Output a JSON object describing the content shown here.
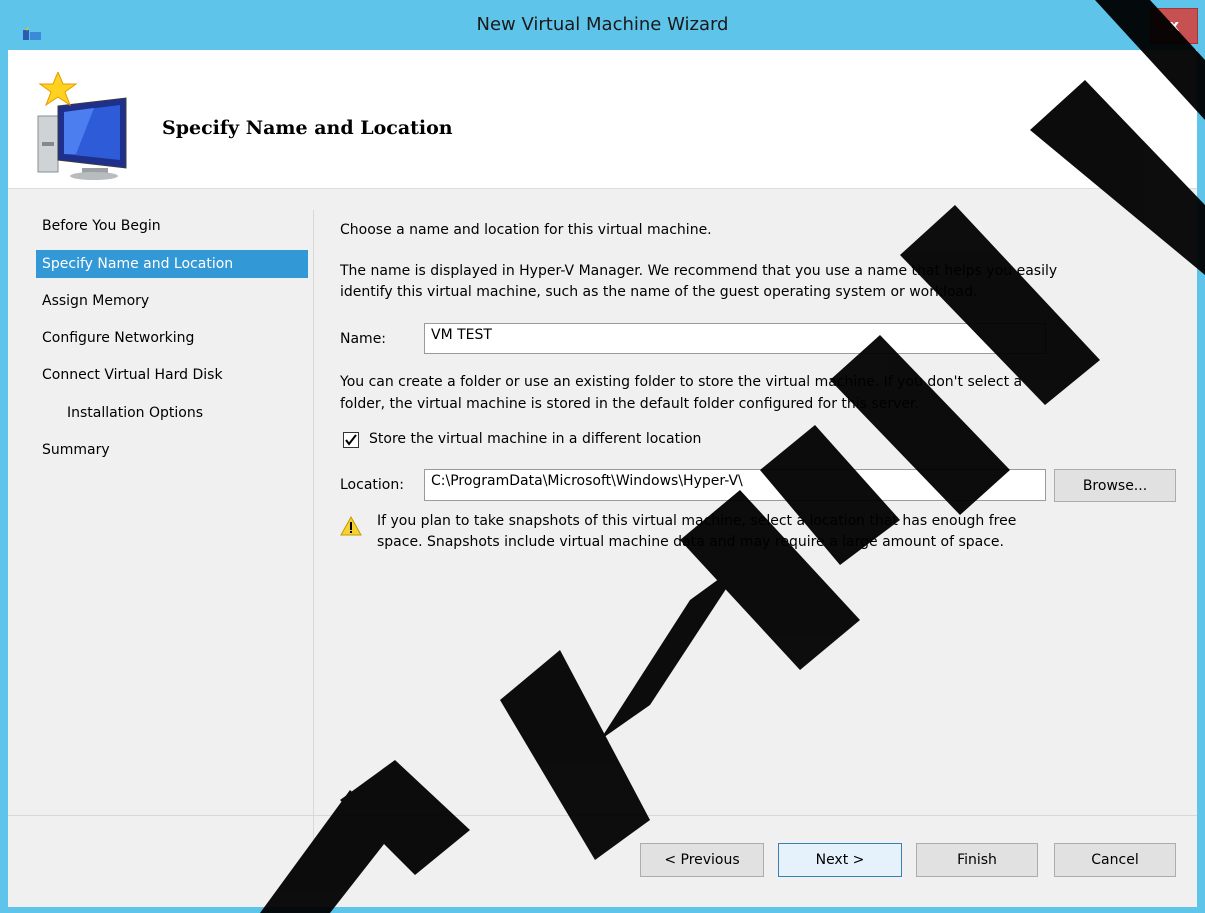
{
  "window": {
    "title": "New Virtual Machine Wizard",
    "close_label": "x",
    "accent_color": "#5fc4ea"
  },
  "header": {
    "title": "Specify Name and Location",
    "icon": "new-virtual-machine-icon"
  },
  "nav": {
    "items": [
      {
        "label": "Before You Begin",
        "selected": false
      },
      {
        "label": "Specify Name and Location",
        "selected": true
      },
      {
        "label": "Assign Memory",
        "selected": false
      },
      {
        "label": "Configure Networking",
        "selected": false
      },
      {
        "label": "Connect Virtual Hard Disk",
        "selected": false
      },
      {
        "label": "Installation Options",
        "selected": false
      },
      {
        "label": "Summary",
        "selected": false
      }
    ],
    "selected_color": "#3399d6"
  },
  "main": {
    "intro": "Choose a name and location for this virtual machine.",
    "desc_line1": "The name is displayed in Hyper-V Manager. We recommend that you use a name that helps you easily",
    "desc_line2": "identify this virtual machine, such as the name of the guest operating system or workload.",
    "name_label": "Name:",
    "name_value": "VM TEST",
    "folder_line1": "You can create a folder or use an existing folder to store the virtual machine. If you don't select a",
    "folder_line2": "folder, the virtual machine is stored in the default folder configured for this server.",
    "store_checkbox_label": "Store the virtual machine in a different location",
    "store_checked": true,
    "location_label": "Location:",
    "location_value": "C:\\ProgramData\\Microsoft\\Windows\\Hyper-V\\",
    "browse_label": "Browse...",
    "warning_line1": "If you plan to take snapshots of this virtual machine, select a location that has enough free",
    "warning_line2": "space. Snapshots include virtual machine data and may require a large amount of space.",
    "warning_icon": "warning-icon"
  },
  "footer": {
    "previous_label": "< Previous",
    "next_label": "Next >",
    "finish_label": "Finish",
    "cancel_label": "Cancel"
  },
  "watermark": {
    "text": "COPYRIGHT",
    "color": "#000000"
  }
}
